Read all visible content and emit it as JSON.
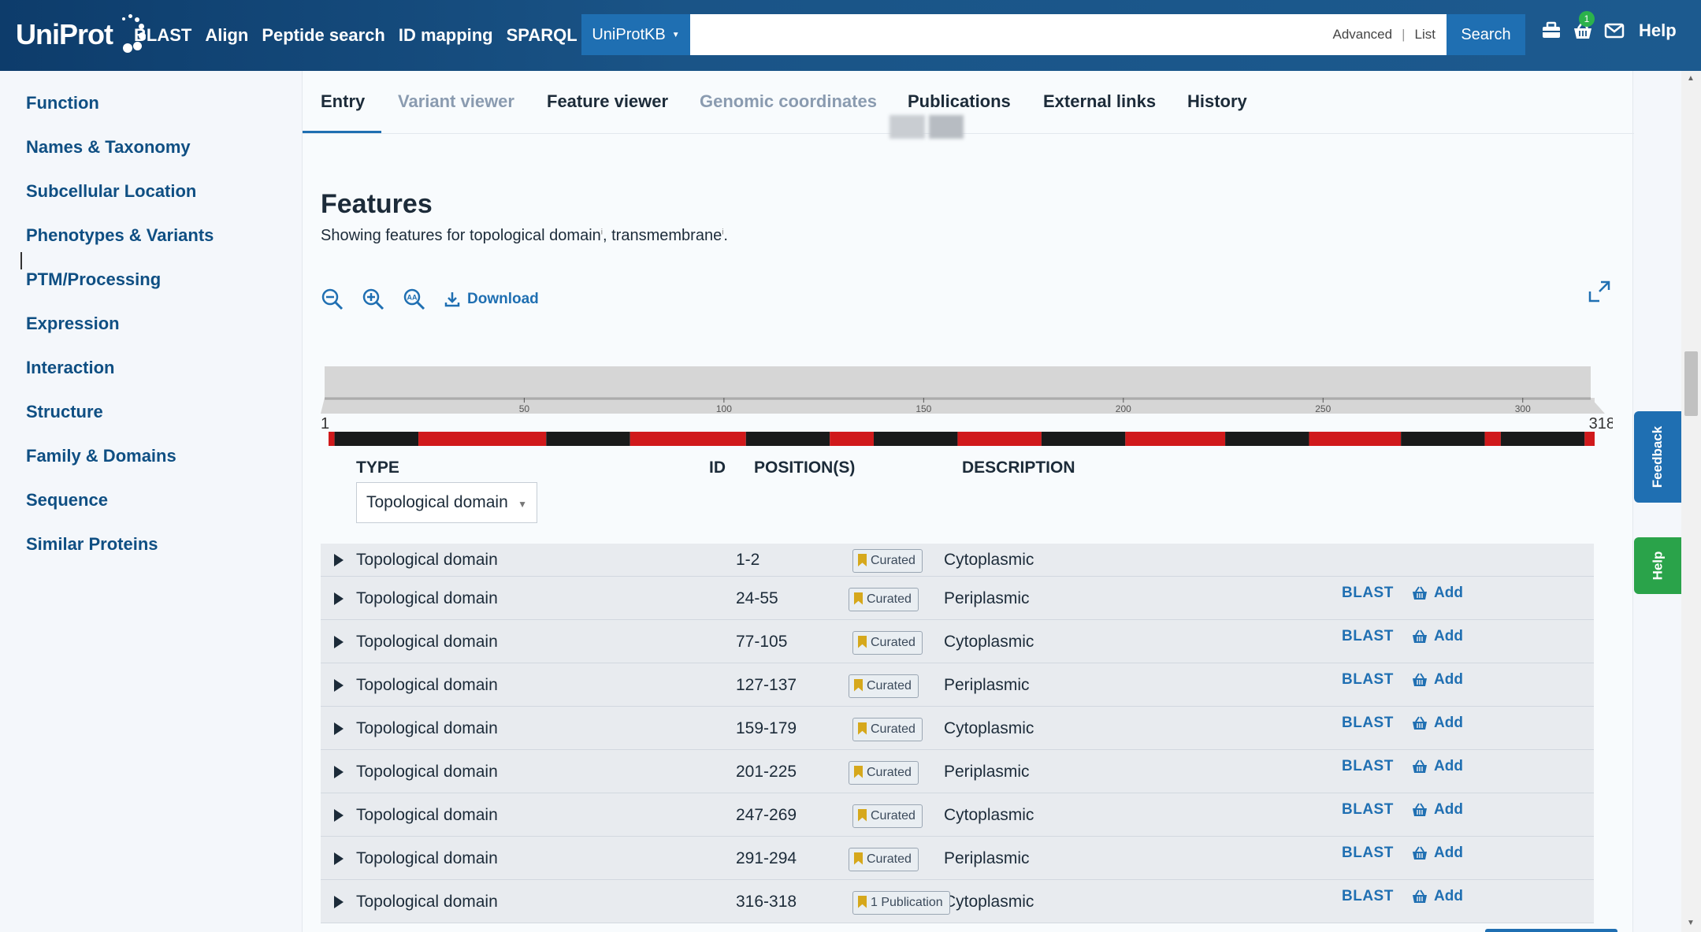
{
  "header": {
    "logo_text": "UniProt",
    "nav": [
      "BLAST",
      "Align",
      "Peptide search",
      "ID mapping",
      "SPARQL"
    ],
    "db_select": "UniProtKB",
    "search_links": {
      "advanced": "Advanced",
      "separator": "|",
      "list": "List"
    },
    "search_button": "Search",
    "basket_count": "1",
    "help": "Help",
    "colors": {
      "bar": "#1a5487",
      "accent": "#1f6fb2"
    }
  },
  "sidebar": {
    "items": [
      "Function",
      "Names & Taxonomy",
      "Subcellular Location",
      "Phenotypes & Variants",
      "PTM/Processing",
      "Expression",
      "Interaction",
      "Structure",
      "Family & Domains",
      "Sequence",
      "Similar Proteins"
    ]
  },
  "tabs": [
    {
      "label": "Entry",
      "active": true
    },
    {
      "label": "Variant viewer",
      "disabled": true
    },
    {
      "label": "Feature viewer"
    },
    {
      "label": "Genomic coordinates",
      "disabled": true
    },
    {
      "label": "Publications"
    },
    {
      "label": "External links"
    },
    {
      "label": "History"
    }
  ],
  "features": {
    "title": "Features",
    "subtitle_prefix": "Showing features for topological domain",
    "subtitle_mid": ", transmembrane",
    "subtitle_end": ".",
    "info_mark": "i",
    "toolbar": {
      "download": "Download",
      "icons": [
        "zoom-out-icon",
        "zoom-in-icon",
        "text-size-icon",
        "download-icon",
        "fullscreen-icon"
      ]
    },
    "ruler": {
      "start_label": "1",
      "end_label": "318",
      "min": 1,
      "max": 318,
      "ticks": [
        50,
        100,
        150,
        200,
        250,
        300
      ]
    },
    "track": {
      "colors": {
        "topological_domain": "#d0191b",
        "transmembrane": "#1a1a1a"
      },
      "segments": [
        {
          "start": 1,
          "end": 2,
          "type": "topological_domain"
        },
        {
          "start": 3,
          "end": 23,
          "type": "transmembrane"
        },
        {
          "start": 24,
          "end": 55,
          "type": "topological_domain"
        },
        {
          "start": 56,
          "end": 76,
          "type": "transmembrane"
        },
        {
          "start": 77,
          "end": 105,
          "type": "topological_domain"
        },
        {
          "start": 106,
          "end": 126,
          "type": "transmembrane"
        },
        {
          "start": 127,
          "end": 137,
          "type": "topological_domain"
        },
        {
          "start": 138,
          "end": 158,
          "type": "transmembrane"
        },
        {
          "start": 159,
          "end": 179,
          "type": "topological_domain"
        },
        {
          "start": 180,
          "end": 200,
          "type": "transmembrane"
        },
        {
          "start": 201,
          "end": 225,
          "type": "topological_domain"
        },
        {
          "start": 226,
          "end": 246,
          "type": "transmembrane"
        },
        {
          "start": 247,
          "end": 269,
          "type": "topological_domain"
        },
        {
          "start": 270,
          "end": 290,
          "type": "transmembrane"
        },
        {
          "start": 291,
          "end": 294,
          "type": "topological_domain"
        },
        {
          "start": 295,
          "end": 315,
          "type": "transmembrane"
        },
        {
          "start": 316,
          "end": 318,
          "type": "topological_domain"
        }
      ]
    },
    "table": {
      "headers": {
        "type": "TYPE",
        "id": "ID",
        "positions": "POSITION(S)",
        "description": "DESCRIPTION"
      },
      "type_filter": "Topological domain",
      "blast_label": "BLAST",
      "add_label": "Add",
      "rows": [
        {
          "type": "Topological domain",
          "position": "1-2",
          "description": "Cytoplasmic",
          "evidence": "Curated",
          "actions": false
        },
        {
          "type": "Topological domain",
          "position": "24-55",
          "description": "Periplasmic",
          "evidence": "Curated",
          "actions": true
        },
        {
          "type": "Topological domain",
          "position": "77-105",
          "description": "Cytoplasmic",
          "evidence": "Curated",
          "actions": true
        },
        {
          "type": "Topological domain",
          "position": "127-137",
          "description": "Periplasmic",
          "evidence": "Curated",
          "actions": true
        },
        {
          "type": "Topological domain",
          "position": "159-179",
          "description": "Cytoplasmic",
          "evidence": "Curated",
          "actions": true
        },
        {
          "type": "Topological domain",
          "position": "201-225",
          "description": "Periplasmic",
          "evidence": "Curated",
          "actions": true
        },
        {
          "type": "Topological domain",
          "position": "247-269",
          "description": "Cytoplasmic",
          "evidence": "Curated",
          "actions": true
        },
        {
          "type": "Topological domain",
          "position": "291-294",
          "description": "Periplasmic",
          "evidence": "Curated",
          "actions": true
        },
        {
          "type": "Topological domain",
          "position": "316-318",
          "description": "Cytoplasmic",
          "evidence": "1 Publication",
          "actions": true
        }
      ]
    }
  },
  "side_tabs": {
    "feedback": "Feedback",
    "help": "Help"
  }
}
